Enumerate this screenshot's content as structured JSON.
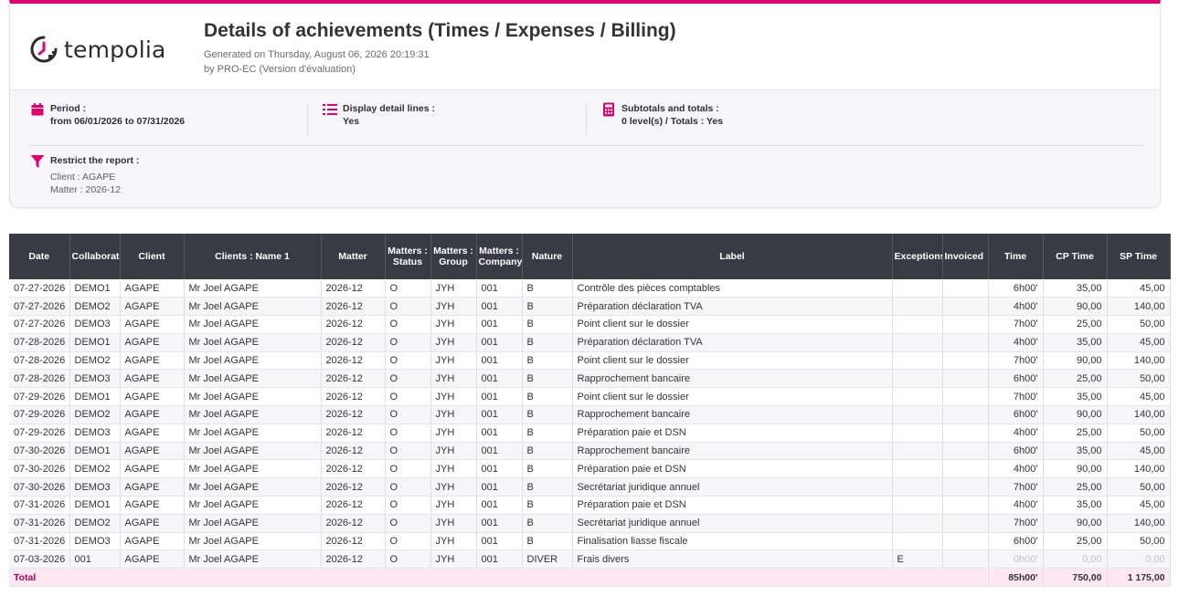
{
  "brand": {
    "name": "tempolia",
    "accent": "#e2006e"
  },
  "report": {
    "title": "Details of achievements (Times / Expenses / Billing)",
    "generated": "Generated on Thursday, August 06, 2026 20:19:31",
    "by": "by PRO-EC (Version d'évaluation)"
  },
  "filters": {
    "period": {
      "icon": "calendar-icon",
      "label": "Period :",
      "value": "from 06/01/2026 to 07/31/2026"
    },
    "detail": {
      "icon": "list-icon",
      "label": "Display detail lines :",
      "value": "Yes"
    },
    "subtotals": {
      "icon": "calculator-icon",
      "label": "Subtotals and totals :",
      "value": "0 level(s) / Totals : Yes"
    },
    "restrict": {
      "icon": "filter-icon",
      "label": "Restrict the report :",
      "client": "Client : AGAPE",
      "matter": "Matter : 2026-12"
    }
  },
  "table": {
    "headers": [
      "Date",
      "Collaborator",
      "Client",
      "Clients : Name 1",
      "Matter",
      "Matters : Status",
      "Matters : Group",
      "Matters : Company",
      "Nature",
      "Label",
      "Exceptions",
      "Invoiced",
      "Time",
      "CP Time",
      "SP Time"
    ],
    "rows": [
      [
        "07-27-2026",
        "DEMO1",
        "AGAPE",
        "Mr Joel AGAPE",
        "2026-12",
        "O",
        "JYH",
        "001",
        "B",
        "Contrôle des pièces comptables",
        "",
        "",
        "6h00'",
        "35,00",
        "45,00"
      ],
      [
        "07-27-2026",
        "DEMO2",
        "AGAPE",
        "Mr Joel AGAPE",
        "2026-12",
        "O",
        "JYH",
        "001",
        "B",
        "Préparation déclaration TVA",
        "",
        "",
        "4h00'",
        "90,00",
        "140,00"
      ],
      [
        "07-27-2026",
        "DEMO3",
        "AGAPE",
        "Mr Joel AGAPE",
        "2026-12",
        "O",
        "JYH",
        "001",
        "B",
        "Point client sur le dossier",
        "",
        "",
        "7h00'",
        "25,00",
        "50,00"
      ],
      [
        "07-28-2026",
        "DEMO1",
        "AGAPE",
        "Mr Joel AGAPE",
        "2026-12",
        "O",
        "JYH",
        "001",
        "B",
        "Préparation déclaration TVA",
        "",
        "",
        "4h00'",
        "35,00",
        "45,00"
      ],
      [
        "07-28-2026",
        "DEMO2",
        "AGAPE",
        "Mr Joel AGAPE",
        "2026-12",
        "O",
        "JYH",
        "001",
        "B",
        "Point client sur le dossier",
        "",
        "",
        "7h00'",
        "90,00",
        "140,00"
      ],
      [
        "07-28-2026",
        "DEMO3",
        "AGAPE",
        "Mr Joel AGAPE",
        "2026-12",
        "O",
        "JYH",
        "001",
        "B",
        "Rapprochement bancaire",
        "",
        "",
        "6h00'",
        "25,00",
        "50,00"
      ],
      [
        "07-29-2026",
        "DEMO1",
        "AGAPE",
        "Mr Joel AGAPE",
        "2026-12",
        "O",
        "JYH",
        "001",
        "B",
        "Point client sur le dossier",
        "",
        "",
        "7h00'",
        "35,00",
        "45,00"
      ],
      [
        "07-29-2026",
        "DEMO2",
        "AGAPE",
        "Mr Joel AGAPE",
        "2026-12",
        "O",
        "JYH",
        "001",
        "B",
        "Rapprochement bancaire",
        "",
        "",
        "6h00'",
        "90,00",
        "140,00"
      ],
      [
        "07-29-2026",
        "DEMO3",
        "AGAPE",
        "Mr Joel AGAPE",
        "2026-12",
        "O",
        "JYH",
        "001",
        "B",
        "Préparation paie et DSN",
        "",
        "",
        "4h00'",
        "25,00",
        "50,00"
      ],
      [
        "07-30-2026",
        "DEMO1",
        "AGAPE",
        "Mr Joel AGAPE",
        "2026-12",
        "O",
        "JYH",
        "001",
        "B",
        "Rapprochement bancaire",
        "",
        "",
        "6h00'",
        "35,00",
        "45,00"
      ],
      [
        "07-30-2026",
        "DEMO2",
        "AGAPE",
        "Mr Joel AGAPE",
        "2026-12",
        "O",
        "JYH",
        "001",
        "B",
        "Préparation paie et DSN",
        "",
        "",
        "4h00'",
        "90,00",
        "140,00"
      ],
      [
        "07-30-2026",
        "DEMO3",
        "AGAPE",
        "Mr Joel AGAPE",
        "2026-12",
        "O",
        "JYH",
        "001",
        "B",
        "Secrétariat juridique annuel",
        "",
        "",
        "7h00'",
        "25,00",
        "50,00"
      ],
      [
        "07-31-2026",
        "DEMO1",
        "AGAPE",
        "Mr Joel AGAPE",
        "2026-12",
        "O",
        "JYH",
        "001",
        "B",
        "Préparation paie et DSN",
        "",
        "",
        "4h00'",
        "35,00",
        "45,00"
      ],
      [
        "07-31-2026",
        "DEMO2",
        "AGAPE",
        "Mr Joel AGAPE",
        "2026-12",
        "O",
        "JYH",
        "001",
        "B",
        "Secrétariat juridique annuel",
        "",
        "",
        "7h00'",
        "90,00",
        "140,00"
      ],
      [
        "07-31-2026",
        "DEMO3",
        "AGAPE",
        "Mr Joel AGAPE",
        "2026-12",
        "O",
        "JYH",
        "001",
        "B",
        "Finalisation liasse fiscale",
        "",
        "",
        "6h00'",
        "25,00",
        "50,00"
      ],
      [
        "07-03-2026",
        "001",
        "AGAPE",
        "Mr Joel AGAPE",
        "2026-12",
        "O",
        "JYH",
        "001",
        "DIVER",
        "Frais divers",
        "E",
        "",
        "0h00'",
        "0,00",
        "0,00"
      ]
    ],
    "dim_rows": [
      15
    ],
    "total": {
      "label": "Total",
      "time": "85h00'",
      "cp_time": "750,00",
      "sp_time": "1 175,00"
    }
  }
}
